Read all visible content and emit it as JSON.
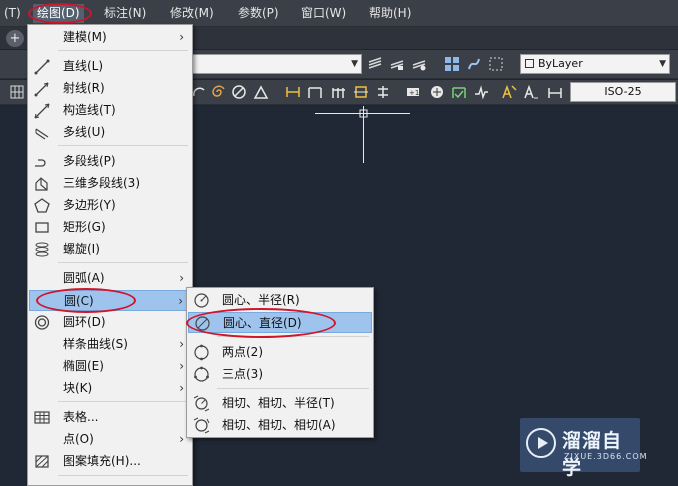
{
  "menubar": {
    "items": [
      "(T)",
      "绘图(D)",
      "标注(N)",
      "修改(M)",
      "参数(P)",
      "窗口(W)",
      "帮助(H)"
    ]
  },
  "toolbar": {
    "plus": "+",
    "layer_combo": "ByLayer",
    "dimstyle_combo": "ISO-25"
  },
  "draw_menu": {
    "items": [
      {
        "label": "建模(M)",
        "icon": "none",
        "submenu": true
      },
      {
        "label": "直线(L)",
        "icon": "line-icon"
      },
      {
        "label": "射线(R)",
        "icon": "ray-icon"
      },
      {
        "label": "构造线(T)",
        "icon": "xline-icon"
      },
      {
        "label": "多线(U)",
        "icon": "mline-icon"
      },
      {
        "label": "多段线(P)",
        "icon": "polyline-icon"
      },
      {
        "label": "三维多段线(3)",
        "icon": "3dpoly-icon"
      },
      {
        "label": "多边形(Y)",
        "icon": "polygon-icon"
      },
      {
        "label": "矩形(G)",
        "icon": "rectangle-icon"
      },
      {
        "label": "螺旋(I)",
        "icon": "helix-icon"
      },
      {
        "label": "圆弧(A)",
        "icon": "none",
        "submenu": true
      },
      {
        "label": "圆(C)",
        "icon": "none",
        "submenu": true,
        "highlighted": true
      },
      {
        "label": "圆环(D)",
        "icon": "donut-icon"
      },
      {
        "label": "样条曲线(S)",
        "icon": "none",
        "submenu": true
      },
      {
        "label": "椭圆(E)",
        "icon": "none",
        "submenu": true
      },
      {
        "label": "块(K)",
        "icon": "none",
        "submenu": true
      },
      {
        "label": "表格...",
        "icon": "table-icon"
      },
      {
        "label": "点(O)",
        "icon": "none",
        "submenu": true
      },
      {
        "label": "图案填充(H)...",
        "icon": "hatch-icon"
      }
    ]
  },
  "circle_menu": {
    "items": [
      {
        "label": "圆心、半径(R)",
        "icon": "circle-center-radius-icon"
      },
      {
        "label": "圆心、直径(D)",
        "icon": "circle-center-diameter-icon",
        "highlighted": true
      },
      {
        "label": "两点(2)",
        "icon": "circle-2point-icon"
      },
      {
        "label": "三点(3)",
        "icon": "circle-3point-icon"
      },
      {
        "label": "相切、相切、半径(T)",
        "icon": "circle-ttr-icon"
      },
      {
        "label": "相切、相切、相切(A)",
        "icon": "circle-ttt-icon"
      }
    ]
  },
  "watermark": {
    "title": "溜溜自学",
    "url": "ZIXUE.3D66.COM"
  },
  "colors": {
    "highlight": "#9ec4ee",
    "annotation_red": "#d0142a",
    "canvas": "#212835"
  }
}
